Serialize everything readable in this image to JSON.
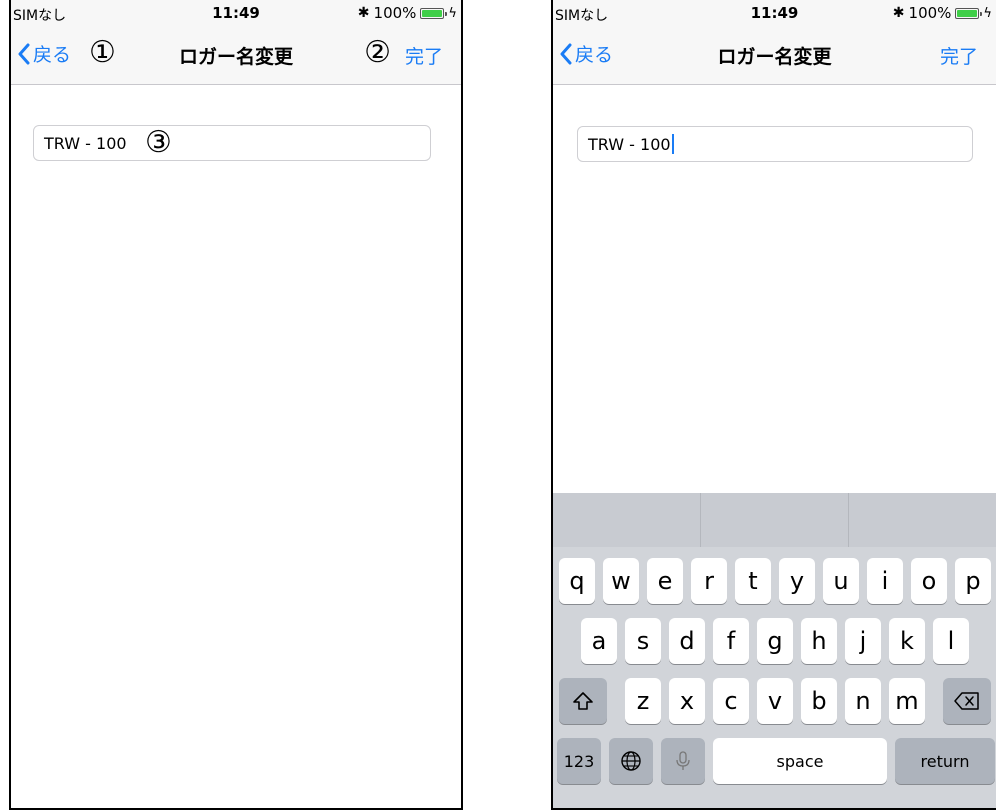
{
  "status_bar": {
    "carrier": "SIMなし",
    "time": "11:49",
    "battery": "100%"
  },
  "nav": {
    "back_label": "戻る",
    "title": "ロガー名変更",
    "done_label": "完了"
  },
  "markers": {
    "back": "①",
    "done": "②",
    "field": "③"
  },
  "field": {
    "value": "TRW - 100"
  },
  "keyboard": {
    "row1": [
      "q",
      "w",
      "e",
      "r",
      "t",
      "y",
      "u",
      "i",
      "o",
      "p"
    ],
    "row2": [
      "a",
      "s",
      "d",
      "f",
      "g",
      "h",
      "j",
      "k",
      "l"
    ],
    "row3": [
      "z",
      "x",
      "c",
      "v",
      "b",
      "n",
      "m"
    ],
    "mode_key": "123",
    "space_key": "space",
    "return_key": "return"
  },
  "colors": {
    "accent": "#1a7cf5",
    "battery": "#3fcf48"
  },
  "icons": [
    "chevron-left-icon",
    "bluetooth-icon",
    "battery-icon",
    "charging-bolt-icon",
    "shift-icon",
    "delete-icon",
    "globe-icon",
    "microphone-icon"
  ]
}
